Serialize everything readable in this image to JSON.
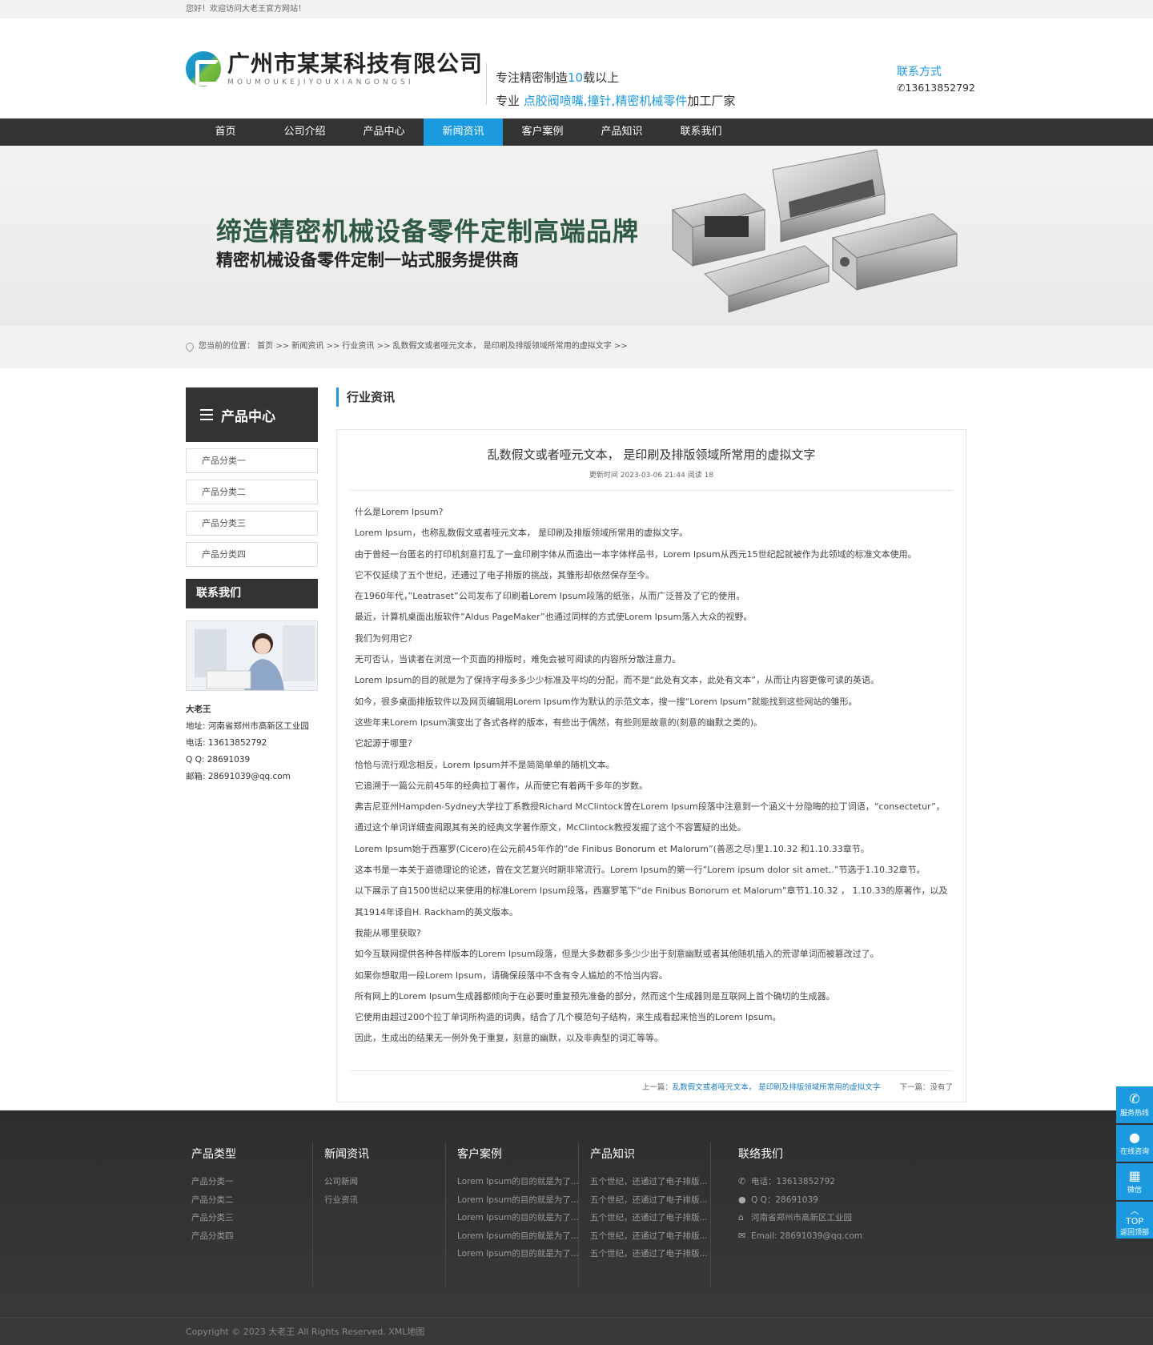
{
  "topbar": {
    "welcome": "您好！欢迎访问大老王官方网站！"
  },
  "header": {
    "company_cn": "广州市某某科技有限公司",
    "company_en": "MOUMOUKEJIYOUXIANGONGSI",
    "slogan1_a": "专注精密制造",
    "slogan1_num": "10",
    "slogan1_b": "载以上",
    "slogan2_a": "专业 ",
    "slogan2_hl": "点胶阀喷嘴,撞针,精密机械零件",
    "slogan2_b": "加工厂家",
    "contact_title": "联系方式",
    "contact_phone": "13613852792"
  },
  "nav": [
    "首页",
    "公司介绍",
    "产品中心",
    "新闻资讯",
    "客户案例",
    "产品知识",
    "联系我们"
  ],
  "nav_active": 3,
  "banner": {
    "title": "缔造精密机械设备零件定制高端品牌",
    "subtitle": "精密机械设备零件定制一站式服务提供商"
  },
  "breadcrumb": "您当前的位置： 首页 >> 新闻资讯 >> 行业资讯 >> 乱数假文或者哑元文本， 是印刷及排版领域所常用的虚拟文字 >>",
  "sidebar": {
    "title": "产品中心",
    "categories": [
      "产品分类一",
      "产品分类二",
      "产品分类三",
      "产品分类四"
    ],
    "contact_title": "联系我们",
    "name": "大老王",
    "address": "地址: 河南省郑州市高新区工业园",
    "phone": "电话: 13613852792",
    "qq": "Q Q: 28691039",
    "email": "邮箱: 28691039@qq.com"
  },
  "content": {
    "section": "行业资讯",
    "title": "乱数假文或者哑元文本， 是印刷及排版领域所常用的虚拟文字",
    "meta": "更新时间  2023-03-06 21:44   阅读 18",
    "paragraphs": [
      "什么是Lorem Ipsum?",
      "Lorem Ipsum，也称乱数假文或者哑元文本， 是印刷及排版领域所常用的虚拟文字。",
      "由于曾经一台匿名的打印机刻意打乱了一盒印刷字体从而造出一本字体样品书，Lorem Ipsum从西元15世纪起就被作为此领域的标准文本使用。",
      "它不仅延续了五个世纪，还通过了电子排版的挑战，其雏形却依然保存至今。",
      "在1960年代，”Leatraset”公司发布了印刷着Lorem Ipsum段落的纸张，从而广泛普及了它的使用。",
      "最近，计算机桌面出版软件”Aldus PageMaker”也通过同样的方式使Lorem Ipsum落入大众的视野。",
      "我们为何用它?",
      "无可否认，当读者在浏览一个页面的排版时，难免会被可阅读的内容所分散注意力。",
      "Lorem Ipsum的目的就是为了保持字母多多少少标准及平均的分配，而不是“此处有文本，此处有文本”，从而让内容更像可读的英语。",
      "如今，很多桌面排版软件以及网页编辑用Lorem Ipsum作为默认的示范文本，搜一搜“Lorem Ipsum”就能找到这些网站的雏形。",
      "这些年来Lorem Ipsum演变出了各式各样的版本，有些出于偶然，有些则是故意的(刻意的幽默之类的)。",
      "它起源于哪里?",
      "恰恰与流行观念相反，Lorem Ipsum并不是简简单单的随机文本。",
      "它追溯于一篇公元前45年的经典拉丁著作，从而使它有着两千多年的岁数。",
      "弗吉尼亚州Hampden-Sydney大学拉丁系教授Richard McClintock曾在Lorem Ipsum段落中注意到一个涵义十分隐晦的拉丁词语，“consectetur”，通过这个单词详细查阅跟其有关的经典文学著作原文，McClintock教授发掘了这个不容置疑的出处。",
      "Lorem Ipsum始于西塞罗(Cicero)在公元前45年作的“de Finibus Bonorum et Malorum”(善恶之尽)里1.10.32 和1.10.33章节。",
      "这本书是一本关于道德理论的论述，曾在文艺复兴时期非常流行。Lorem Ipsum的第一行”Lorem ipsum dolor sit amet..”节选于1.10.32章节。",
      "以下展示了自1500世纪以来使用的标准Lorem Ipsum段落，西塞罗笔下“de Finibus Bonorum et Malorum”章节1.10.32 ， 1.10.33的原著作，以及其1914年译自H. Rackham的英文版本。",
      "我能从哪里获取?",
      "如今互联网提供各种各样版本的Lorem Ipsum段落，但是大多数都多多少少出于刻意幽默或者其他随机插入的荒谬单词而被篡改过了。",
      "如果你想取用一段Lorem Ipsum，请确保段落中不含有令人尴尬的不恰当内容。",
      "所有网上的Lorem Ipsum生成器都倾向于在必要时重复预先准备的部分，然而这个生成器则是互联网上首个确切的生成器。",
      "它使用由超过200个拉丁单词所构造的词典，结合了几个模范句子结构，来生成看起来恰当的Lorem Ipsum。",
      "因此，生成出的结果无一例外免于重复，刻意的幽默，以及非典型的词汇等等。"
    ],
    "prev_label": "上一篇：",
    "prev_title": "乱数假文或者哑元文本， 是印刷及排版领域所常用的虚拟文字",
    "next_label": "下一篇：",
    "next_title": "没有了"
  },
  "footer": {
    "col1": {
      "title": "产品类型",
      "items": [
        "产品分类一",
        "产品分类二",
        "产品分类三",
        "产品分类四"
      ]
    },
    "col2": {
      "title": "新闻资讯",
      "items": [
        "公司新闻",
        "行业资讯"
      ]
    },
    "col3": {
      "title": "客户案例",
      "items": [
        "Lorem Ipsum的目的就是为了...",
        "Lorem Ipsum的目的就是为了...",
        "Lorem Ipsum的目的就是为了...",
        "Lorem Ipsum的目的就是为了...",
        "Lorem Ipsum的目的就是为了..."
      ]
    },
    "col4": {
      "title": "产品知识",
      "items": [
        "五个世纪，还通过了电子排版...",
        "五个世纪，还通过了电子排版...",
        "五个世纪，还通过了电子排版...",
        "五个世纪，还通过了电子排版...",
        "五个世纪，还通过了电子排版..."
      ]
    },
    "col5": {
      "title": "联络我们",
      "phone": "电话：13613852792",
      "qq": "Q Q：28691039",
      "address": "河南省郑州市高新区工业园",
      "email": "Email: 28691039@qq.com"
    },
    "copyright": "Copyright © 2023 大老王 All Rights Reserved.  XML地图"
  },
  "float": {
    "hotline": "服务热线",
    "consult": "在线咨询",
    "wechat": "微信",
    "top": "TOP",
    "back_top": "返回顶部"
  }
}
